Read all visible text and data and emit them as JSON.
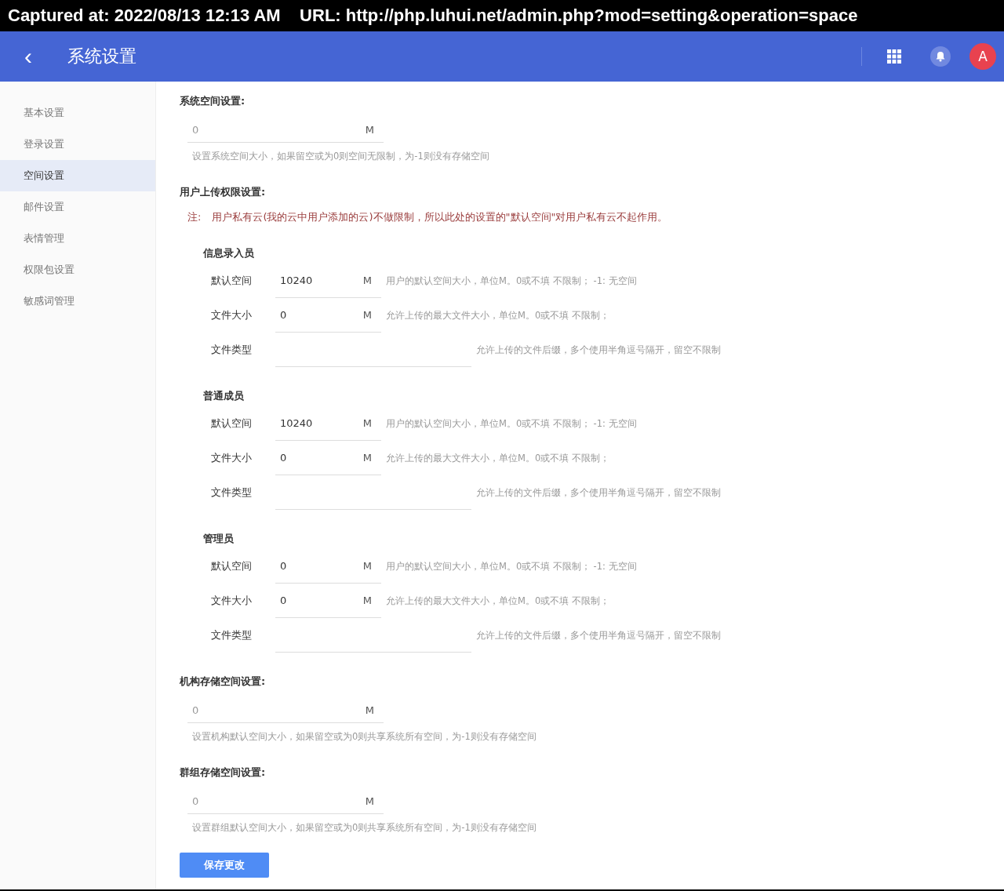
{
  "capture_bar": {
    "text": "Captured at: 2022/08/13 12:13 AM    URL: http://php.luhui.net/admin.php?mod=setting&operation=space"
  },
  "header": {
    "back": "‹",
    "title": "系统设置",
    "avatar": "A"
  },
  "sidebar": {
    "items": [
      {
        "label": "基本设置",
        "selected": false
      },
      {
        "label": "登录设置",
        "selected": false
      },
      {
        "label": "空间设置",
        "selected": true
      },
      {
        "label": "邮件设置",
        "selected": false
      },
      {
        "label": "表情管理",
        "selected": false
      },
      {
        "label": "权限包设置",
        "selected": false
      },
      {
        "label": "敏感词管理",
        "selected": false
      }
    ]
  },
  "sections": [
    {
      "kind": "single",
      "title": "系统空间设置:",
      "placeholder": "0",
      "unit": "M",
      "hint": "设置系统空间大小，如果留空或为0则空间无限制，为-1则没有存储空间"
    },
    {
      "kind": "roles",
      "title": "用户上传权限设置:",
      "note_label": "注:",
      "note": "用户私有云(我的云中用户添加的云)不做限制，所以此处的设置的\"默认空间\"对用户私有云不起作用。",
      "groups": [
        {
          "name": "信息录入员",
          "rows": [
            {
              "kind": "unit",
              "label": "默认空间",
              "value": "10240",
              "unit": "M",
              "hint": "用户的默认空间大小，单位M。0或不填 不限制； -1: 无空间"
            },
            {
              "kind": "unit",
              "label": "文件大小",
              "value": "0",
              "unit": "M",
              "hint": "允许上传的最大文件大小，单位M。0或不填 不限制；"
            },
            {
              "kind": "text",
              "label": "文件类型",
              "hint": "允许上传的文件后缀，多个使用半角逗号隔开，留空不限制"
            }
          ]
        },
        {
          "name": "普通成员",
          "rows": [
            {
              "kind": "unit",
              "label": "默认空间",
              "value": "10240",
              "unit": "M",
              "hint": "用户的默认空间大小，单位M。0或不填 不限制； -1: 无空间"
            },
            {
              "kind": "unit",
              "label": "文件大小",
              "value": "0",
              "unit": "M",
              "hint": "允许上传的最大文件大小，单位M。0或不填 不限制；"
            },
            {
              "kind": "text",
              "label": "文件类型",
              "hint": "允许上传的文件后缀，多个使用半角逗号隔开，留空不限制"
            }
          ]
        },
        {
          "name": "管理员",
          "rows": [
            {
              "kind": "unit",
              "label": "默认空间",
              "value": "0",
              "unit": "M",
              "hint": "用户的默认空间大小，单位M。0或不填 不限制； -1: 无空间"
            },
            {
              "kind": "unit",
              "label": "文件大小",
              "value": "0",
              "unit": "M",
              "hint": "允许上传的最大文件大小，单位M。0或不填 不限制；"
            },
            {
              "kind": "text",
              "label": "文件类型",
              "hint": "允许上传的文件后缀，多个使用半角逗号隔开，留空不限制"
            }
          ]
        }
      ]
    },
    {
      "kind": "single",
      "title": "机构存储空间设置:",
      "placeholder": "0",
      "unit": "M",
      "hint": "设置机构默认空间大小，如果留空或为0则共享系统所有空间，为-1则没有存储空间"
    },
    {
      "kind": "single",
      "title": "群组存储空间设置:",
      "placeholder": "0",
      "unit": "M",
      "hint": "设置群组默认空间大小，如果留空或为0则共享系统所有空间，为-1则没有存储空间"
    }
  ],
  "save_button": "保存更改"
}
